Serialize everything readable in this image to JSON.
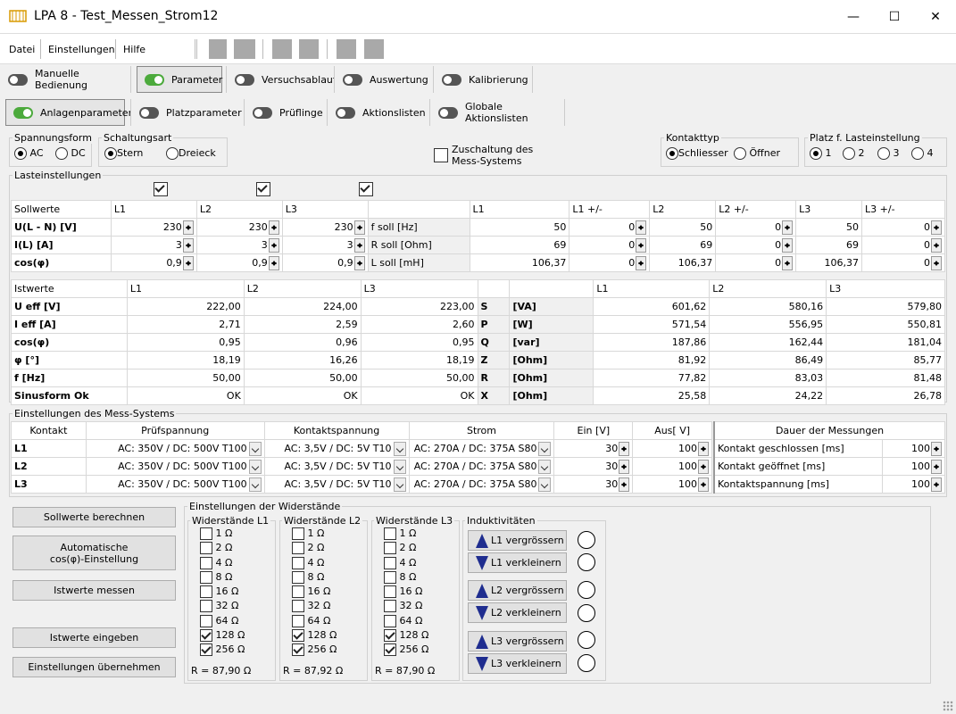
{
  "window": {
    "title": "LPA 8 - Test_Messen_Strom12",
    "min": "—",
    "max": "☐",
    "close": "✕"
  },
  "menu": {
    "datei": "Datei",
    "einstellungen": "Einstellungen",
    "hilfe": "Hilfe"
  },
  "tabs1": [
    "Manuelle Bedienung",
    "Parameter",
    "Versuchsablauf",
    "Auswertung",
    "Kalibrierung"
  ],
  "tabs2": [
    "Anlagenparameter",
    "Platzparameter",
    "Prüflinge",
    "Aktionslisten",
    "Globale Aktionslisten"
  ],
  "spannungsform": {
    "label": "Spannungsform",
    "ac": "AC",
    "dc": "DC"
  },
  "schaltungsart": {
    "label": "Schaltungsart",
    "stern": "Stern",
    "dreieck": "Dreieck"
  },
  "zuschaltung": "Zuschaltung des\nMess-Systems",
  "kontakttyp": {
    "label": "Kontakttyp",
    "schliesser": "Schliesser",
    "oeffner": "Öffner"
  },
  "platz": {
    "label": "Platz f. Lasteinstellung",
    "o1": "1",
    "o2": "2",
    "o3": "3",
    "o4": "4"
  },
  "last": {
    "label": "Lasteinstellungen"
  },
  "soll": {
    "header": [
      "Sollwerte",
      "L1",
      "L2",
      "L3",
      "",
      "L1",
      "L1 +/-",
      "L2",
      "L2 +/-",
      "L3",
      "L3 +/-"
    ],
    "rows": [
      {
        "name": "U(L - N) [V]",
        "v": [
          "230",
          "230",
          "230"
        ],
        "lbl": "f soll  [Hz]",
        "w": [
          "50",
          "0",
          "50",
          "0",
          "50",
          "0"
        ]
      },
      {
        "name": "I(L) [A]",
        "v": [
          "3",
          "3",
          "3"
        ],
        "lbl": "R soll [Ohm]",
        "w": [
          "69",
          "0",
          "69",
          "0",
          "69",
          "0"
        ]
      },
      {
        "name": "cos(φ)",
        "v": [
          "0,9",
          "0,9",
          "0,9"
        ],
        "lbl": "L soll  [mH]",
        "w": [
          "106,37",
          "0",
          "106,37",
          "0",
          "106,37",
          "0"
        ]
      }
    ]
  },
  "ist": {
    "header": [
      "Istwerte",
      "L1",
      "L2",
      "L3",
      "",
      "",
      "L1",
      "L2",
      "L3"
    ],
    "rows": [
      {
        "name": "U eff  [V]",
        "v": [
          "222,00",
          "224,00",
          "223,00"
        ],
        "s": "S",
        "u": "[VA]",
        "w": [
          "601,62",
          "580,16",
          "579,80"
        ]
      },
      {
        "name": "I eff   [A]",
        "v": [
          "2,71",
          "2,59",
          "2,60"
        ],
        "s": "P",
        "u": "[W]",
        "w": [
          "571,54",
          "556,95",
          "550,81"
        ]
      },
      {
        "name": "cos(φ)",
        "v": [
          "0,95",
          "0,96",
          "0,95"
        ],
        "s": "Q",
        "u": "[var]",
        "w": [
          "187,86",
          "162,44",
          "181,04"
        ]
      },
      {
        "name": "φ      [°]",
        "v": [
          "18,19",
          "16,26",
          "18,19"
        ],
        "s": "Z",
        "u": "[Ohm]",
        "w": [
          "81,92",
          "86,49",
          "85,77"
        ]
      },
      {
        "name": "f        [Hz]",
        "v": [
          "50,00",
          "50,00",
          "50,00"
        ],
        "s": "R",
        "u": "[Ohm]",
        "w": [
          "77,82",
          "83,03",
          "81,48"
        ]
      },
      {
        "name": "Sinusform Ok",
        "v": [
          "OK",
          "OK",
          "OK"
        ],
        "s": "X",
        "u": "[Ohm]",
        "w": [
          "25,58",
          "24,22",
          "26,78"
        ]
      }
    ]
  },
  "mess": {
    "label": "Einstellungen des Mess-Systems",
    "header": [
      "Kontakt",
      "Prüfspannung",
      "Kontaktspannung",
      "Strom",
      "Ein [V]",
      "Aus[ V]"
    ],
    "rows": [
      {
        "k": "L1",
        "p": "AC:  350V / DC:  500V T100",
        "ks": "AC: 3,5V  / DC:  5V T10",
        "s": "AC: 270A / DC: 375A S80",
        "ein": "30",
        "aus": "100"
      },
      {
        "k": "L2",
        "p": "AC:  350V / DC:  500V T100",
        "ks": "AC: 3,5V  / DC:  5V T10",
        "s": "AC: 270A / DC: 375A S80",
        "ein": "30",
        "aus": "100"
      },
      {
        "k": "L3",
        "p": "AC:  350V / DC:  500V T100",
        "ks": "AC: 3,5V  / DC:  5V T10",
        "s": "AC: 270A / DC: 375A S80",
        "ein": "30",
        "aus": "100"
      }
    ],
    "dauer": {
      "header": "Dauer der Messungen",
      "rows": [
        {
          "l": "Kontakt geschlossen [ms]",
          "v": "100"
        },
        {
          "l": "Kontakt geöffnet [ms]",
          "v": "100"
        },
        {
          "l": "Kontaktspannung [ms]",
          "v": "100"
        }
      ]
    }
  },
  "buttons": {
    "sollwerte": "Sollwerte berechnen",
    "auto": "Automatische\ncos(φ)-Einstellung",
    "istmessen": "Istwerte messen",
    "isteingeben": "Istwerte eingeben",
    "uebernehmen": "Einstellungen übernehmen"
  },
  "wid": {
    "label": "Einstellungen der Widerstände",
    "ohms": [
      "1 Ω",
      "2 Ω",
      "4 Ω",
      "8 Ω",
      "16 Ω",
      "32 Ω",
      "64 Ω",
      "128 Ω",
      "256 Ω"
    ],
    "cols": [
      {
        "title": "Widerstände L1",
        "r": "R = 87,90 Ω"
      },
      {
        "title": "Widerstände L2",
        "r": "R = 87,92 Ω"
      },
      {
        "title": "Widerstände L3",
        "r": "R = 87,90 Ω"
      }
    ]
  },
  "ind": {
    "label": "Induktivitäten",
    "buttons": [
      "L1 vergrössern",
      "L1 verkleinern",
      "L2 vergrössern",
      "L2 verkleinern",
      "L3 vergrössern",
      "L3 verkleinern"
    ]
  }
}
